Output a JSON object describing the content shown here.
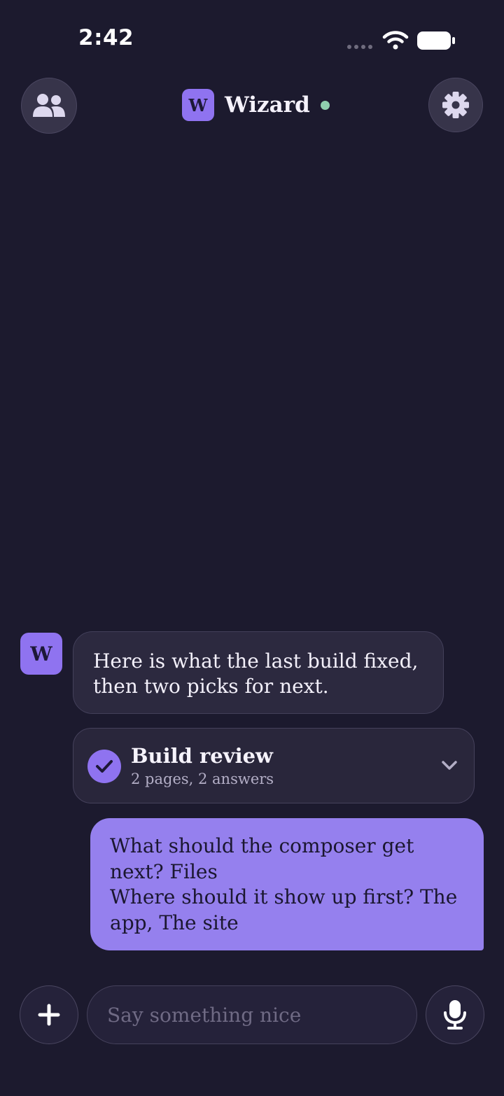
{
  "status_bar": {
    "time": "2:42",
    "wifi_icon": "wifi-icon",
    "battery_icon": "battery-icon"
  },
  "header": {
    "people_icon": "people-icon",
    "avatar_letter": "W",
    "title": "Wizard",
    "online": true,
    "online_color": "#8fcfae",
    "settings_icon": "gear-icon"
  },
  "messages": {
    "bot_avatar_letter": "W",
    "bot_text_lines": [
      "Here is what the last build fixed,",
      "then two picks for next."
    ],
    "review_card": {
      "title": "Build review",
      "subtitle": "2 pages, 2 answers",
      "status_icon": "check-circle-icon",
      "expand_icon": "chevron-down-icon"
    },
    "user_text_lines": [
      "What should the composer get",
      "next? Files",
      "Where should it show up first? The",
      "app, The site"
    ]
  },
  "composer": {
    "placeholder": "Say something nice",
    "value": "",
    "add_icon": "plus-icon",
    "mic_icon": "microphone-icon"
  },
  "colors": {
    "background": "#1c1a2e",
    "accent": "#8f73f0",
    "user_bubble": "#9580ee",
    "bot_bubble": "#2c293f"
  }
}
